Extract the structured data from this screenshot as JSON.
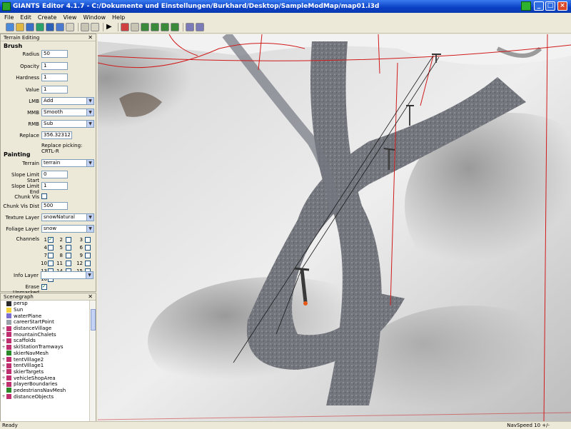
{
  "window": {
    "title": "GIANTS Editor 4.1.7 - C:/Dokumente und Einstellungen/Burkhard/Desktop/SampleModMap/map01.i3d"
  },
  "menu": [
    "File",
    "Edit",
    "Create",
    "View",
    "Window",
    "Help"
  ],
  "terrain_panel": {
    "title": "Terrain Editing",
    "brush_section": "Brush",
    "radius_label": "Radius",
    "radius_value": "50",
    "opacity_label": "Opacity",
    "opacity_value": "1",
    "hardness_label": "Hardness",
    "hardness_value": "1",
    "value_label": "Value",
    "value_value": "1",
    "lmb_label": "LMB",
    "lmb_value": "Add",
    "mmb_label": "MMB",
    "mmb_value": "Smooth",
    "rmb_label": "RMB",
    "rmb_value": "Sub",
    "replace_label": "Replace",
    "replace_value": "356.32312",
    "replace_hint": "Replace picking: CRTL-R",
    "painting_section": "Painting",
    "terrain_label": "Terrain",
    "terrain_value": "terrain",
    "slope_start_label": "Slope Limit Start",
    "slope_start_value": "0",
    "slope_end_label": "Slope Limit End",
    "slope_end_value": "1",
    "chunk_vis_label": "Chunk Vis",
    "chunk_vis_dist_label": "Chunk Vis Dist",
    "chunk_vis_dist_value": "500",
    "texture_layer_label": "Texture Layer",
    "texture_layer_value": "snowNatural",
    "foliage_layer_label": "Foliage Layer",
    "foliage_layer_value": "snow",
    "channels_label": "Channels",
    "channels": [
      "1",
      "2",
      "3",
      "4",
      "5",
      "6",
      "7",
      "8",
      "9",
      "10",
      "11",
      "12",
      "13",
      "14",
      "15",
      "16"
    ],
    "erase_unmasked_label": "Erase Unmasked",
    "info_layer_label": "Info Layer",
    "info_layer_value": ""
  },
  "scenegraph": {
    "title": "Scenegraph",
    "items": [
      {
        "label": "persp",
        "expand": "",
        "icon": "camera-icon",
        "color": "#2a2a2a"
      },
      {
        "label": "Sun",
        "expand": "",
        "icon": "light-icon",
        "color": "#f5d33a"
      },
      {
        "label": "waterPlane",
        "expand": "",
        "icon": "shape-icon",
        "color": "#7a6fd0"
      },
      {
        "label": "careerStartPoint",
        "expand": "",
        "icon": "transform-icon",
        "color": "#9aa0a8"
      },
      {
        "label": "distanceVillage",
        "expand": "+",
        "icon": "group-icon",
        "color": "#c03070"
      },
      {
        "label": "mountainChalets",
        "expand": "+",
        "icon": "group-icon",
        "color": "#c03070"
      },
      {
        "label": "scaffolds",
        "expand": "+",
        "icon": "group-icon",
        "color": "#c03070"
      },
      {
        "label": "skiStationTramways",
        "expand": "+",
        "icon": "group-icon",
        "color": "#c03070"
      },
      {
        "label": "skierNavMesh",
        "expand": "",
        "icon": "navmesh-icon",
        "color": "#2a8a2a"
      },
      {
        "label": "tentVillage2",
        "expand": "+",
        "icon": "group-icon",
        "color": "#c03070"
      },
      {
        "label": "tentVillage1",
        "expand": "+",
        "icon": "group-icon",
        "color": "#c03070"
      },
      {
        "label": "skierTargets",
        "expand": "+",
        "icon": "group-icon",
        "color": "#c03070"
      },
      {
        "label": "vehicleShopArea",
        "expand": "+",
        "icon": "group-icon",
        "color": "#c03070"
      },
      {
        "label": "playerBoundaries",
        "expand": "+",
        "icon": "group-icon",
        "color": "#c03070"
      },
      {
        "label": "pedestriansNavMesh",
        "expand": "",
        "icon": "navmesh-icon",
        "color": "#2a8a2a"
      },
      {
        "label": "distanceObjects",
        "expand": "+",
        "icon": "group-icon",
        "color": "#c03070"
      }
    ]
  },
  "status": {
    "left": "Ready",
    "right": "NavSpeed 10 +/-"
  },
  "colors": {
    "title_bar": "#0a3fc4",
    "panel_bg": "#ece9d8",
    "boundary_line": "#d01a1a",
    "snow": "#e6e6e6",
    "piste": "#6e7078"
  }
}
